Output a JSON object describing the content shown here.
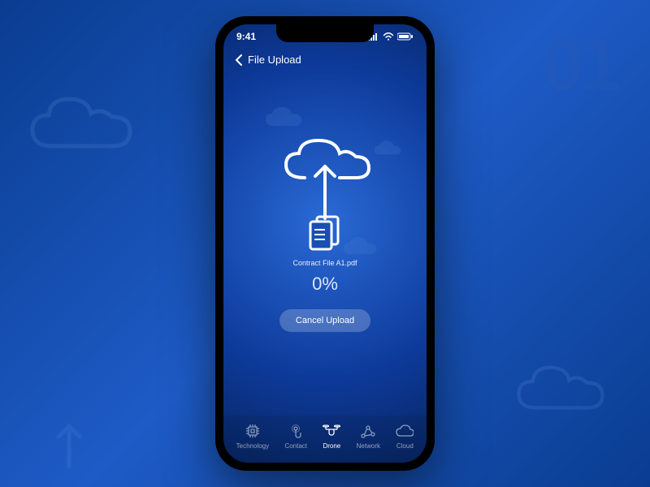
{
  "page_number": "01",
  "status": {
    "time": "9:41"
  },
  "header": {
    "title": "File Upload"
  },
  "upload": {
    "filename": "Contract File A1.pdf",
    "progress": "0%",
    "cancel_label": "Cancel Upload"
  },
  "tabs": [
    {
      "label": "Technology"
    },
    {
      "label": "Contact"
    },
    {
      "label": "Drone"
    },
    {
      "label": "Network"
    },
    {
      "label": "Cloud"
    }
  ]
}
